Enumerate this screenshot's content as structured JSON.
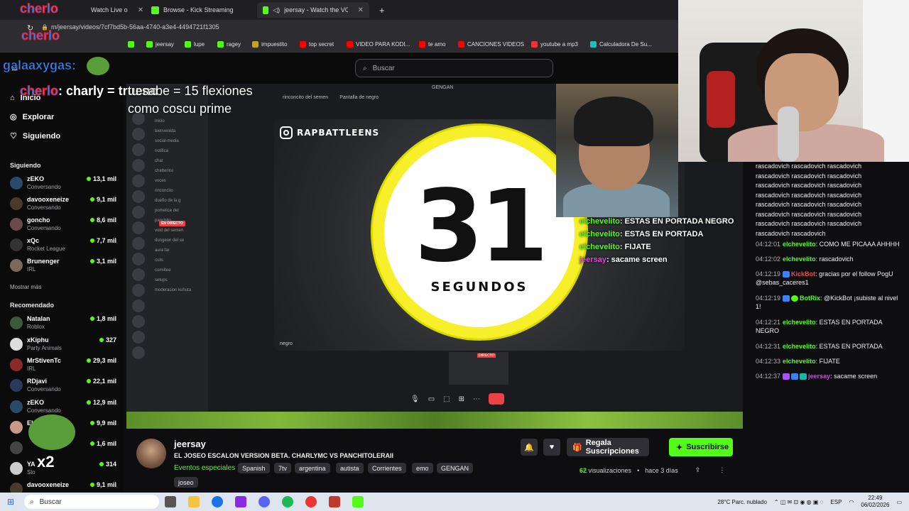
{
  "browser": {
    "tabs": [
      {
        "label": "Watch Live o",
        "active": false
      },
      {
        "label": "Browse - Kick Streaming",
        "active": false
      },
      {
        "label": "jeersay - Watch the VOD on K",
        "active": true
      }
    ],
    "url": "m/jeersay/videos/7cf7bd5b-56aa-4740-a3e4-4494721f1305",
    "bookmarks": [
      "jeersay",
      "lupe",
      "ragey",
      "impuestito",
      "top secret",
      "VIDEO PARA KODI...",
      "te amo",
      "CANCIONES VIDEOS",
      "youtube a mp3",
      "Calculadora De Su..."
    ]
  },
  "header": {
    "search_placeholder": "Buscar"
  },
  "sidebar": {
    "nav": [
      {
        "label": "Inicio"
      },
      {
        "label": "Explorar"
      },
      {
        "label": "Siguiendo"
      }
    ],
    "following_title": "Siguiendo",
    "following": [
      {
        "name": "zEKO",
        "sub": "Conversando",
        "viewers": "13,1 mil"
      },
      {
        "name": "davooxeneize",
        "sub": "Conversando",
        "viewers": "9,1 mil"
      },
      {
        "name": "goncho",
        "sub": "Conversando",
        "viewers": "8,6 mil"
      },
      {
        "name": "xQc",
        "sub": "Rocket League",
        "viewers": "7,7 mil"
      },
      {
        "name": "Brunenger",
        "sub": "IRL",
        "viewers": "3,1 mil"
      }
    ],
    "show_more": "Mostrar más",
    "recommended_title": "Recomendado",
    "recommended": [
      {
        "name": "Natalan",
        "sub": "Roblox",
        "viewers": "1,8 mil"
      },
      {
        "name": "xKiphu",
        "sub": "Party Animals",
        "viewers": "327"
      },
      {
        "name": "MrStivenTc",
        "sub": "IRL",
        "viewers": "29,3 mil"
      },
      {
        "name": "RDjavi",
        "sub": "Conversando",
        "viewers": "22,1 mil"
      },
      {
        "name": "zEKO",
        "sub": "Conversando",
        "viewers": "12,9 mil"
      },
      {
        "name": "El",
        "sub": "",
        "viewers": "9,9 mil"
      },
      {
        "name": "",
        "sub": "",
        "viewers": "1,6 mil"
      },
      {
        "name": "YA",
        "sub": "Slo",
        "viewers": "314"
      },
      {
        "name": "davooxeneize",
        "sub": "",
        "viewers": "9,1 mil"
      }
    ]
  },
  "overlay": {
    "user1": "cherlo",
    "user2": "cherlo",
    "user3": "galaaxygas:",
    "line_top_user": "cherlo",
    "line_top_text": ": charly = trueno",
    "line_overlap": "tu sabe = 15 flexiones",
    "line_overlap2": "como coscu prime",
    "emote_label": "x2"
  },
  "stream": {
    "brand": "RAPBATTLEENS",
    "count": "31",
    "count_unit": "SEGUNDOS",
    "gengan_label": "GENGAN",
    "discord_channel": "rinconcito del semen",
    "discord_share": "Pantalla de negro",
    "screen_label": "negro",
    "live_label": "EN DIRECTO",
    "directo_label": "DIRECTO"
  },
  "discord_list": [
    "inicio",
    "bienvenida",
    "social-media",
    "notifica",
    "chat",
    "chatterino",
    "voces",
    "rinconcito",
    "dueño de la g",
    "pomelice del",
    "panchito",
    "void del semen",
    "dungeon del se",
    "aura far",
    "culis",
    "comiitea",
    "setups",
    "moderacion kuhuta"
  ],
  "cam_chat": [
    {
      "user": "elchevelito",
      "text": ": ESTAS EN PORTADA NEGRO"
    },
    {
      "user": "elchevelito",
      "text": ": ESTAS EN PORTADA"
    },
    {
      "user": "elchevelito",
      "text": ": FIJATE"
    },
    {
      "user": "jeersay",
      "text": ": sacame screen"
    }
  ],
  "chat": {
    "spam_lines": [
      "rascadovich rascadovich rascadovich",
      "rascadovich rascadovich rascadovich",
      "rascadovich rascadovich rascadovich",
      "rascadovich rascadovich rascadovich",
      "rascadovich rascadovich rascadovich",
      "rascadovich rascadovich rascadovich",
      "rascadovich rascadovich rascadovich",
      "rascadovich rascadovich"
    ],
    "messages": [
      {
        "time": "04:12:01",
        "user": "elchevelito",
        "text": ": COMO ME PICAAA AHHHH"
      },
      {
        "time": "04:12:02",
        "user": "elchevelito",
        "text": ": rascadovich"
      },
      {
        "time": "04:12:19",
        "user": "KickBot",
        "text": ": gracias por el follow PogU @sebas_caceres1"
      },
      {
        "time": "04:12:19",
        "user": "BotRix",
        "text": ": @KickBot ¡subiste al nivel 1!"
      },
      {
        "time": "04:12:21",
        "user": "elchevelito",
        "text": ": ESTAS EN PORTADA NEGRO"
      },
      {
        "time": "04:12:31",
        "user": "elchevelito",
        "text": ": ESTAS EN PORTADA"
      },
      {
        "time": "04:12:33",
        "user": "elchevelito",
        "text": ": FIJATE"
      },
      {
        "time": "04:12:37",
        "user": "jeersay",
        "text": ": sacame screen"
      }
    ]
  },
  "info": {
    "streamer": "jeersay",
    "title": "EL JOSEO ESCALON VERSION BETA. CHARLYMC VS PANCHITOLERAII",
    "category": "Eventos especiales",
    "tags": [
      "Spanish",
      "7tv",
      "argentina",
      "autista",
      "Corrientes",
      "emo",
      "GENGAN",
      "joseo"
    ],
    "gift_label": "Regala Suscripciones",
    "subscribe_label": "Suscribirse",
    "views_count": "62",
    "views_label": "visualizaciones",
    "dot": "•",
    "ago": "hace 3 días"
  },
  "taskbar": {
    "search": "Buscar",
    "weather": "28°C  Parc. nublado",
    "lang": "ESP",
    "time": "22:49",
    "date": "06/02/2026"
  }
}
